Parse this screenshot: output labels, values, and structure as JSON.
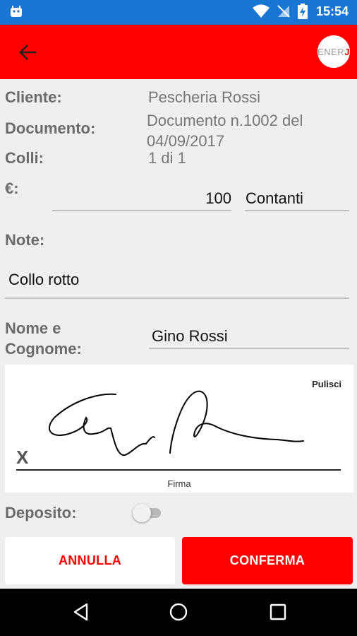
{
  "status_bar": {
    "time": "15:54",
    "icons": [
      "android-icon",
      "wifi-icon",
      "no-sim-icon",
      "battery-charging-icon"
    ]
  },
  "app_bar": {
    "back_icon": "arrow-left-icon",
    "logo": {
      "part1": "ENER",
      "part2": "J"
    },
    "colors": {
      "accent": "#ff0000"
    }
  },
  "form": {
    "cliente": {
      "label": "Cliente:",
      "value": "Pescheria Rossi"
    },
    "documento": {
      "label": "Documento:",
      "line1": "Documento n.1002 del",
      "line2": "04/09/2017"
    },
    "colli": {
      "label": "Colli:",
      "value": "1 di 1"
    },
    "amount": {
      "label": "€:",
      "value": "100",
      "payment": "Contanti"
    },
    "note": {
      "label": "Note:",
      "value": "Collo rotto"
    },
    "nome": {
      "label_line1": "Nome e",
      "label_line2": "Cognome:",
      "value": "Gino Rossi"
    }
  },
  "signature": {
    "clear_label": "Pulisci",
    "x_mark": "X",
    "caption": "Firma"
  },
  "deposito": {
    "label": "Deposito:",
    "checked": false
  },
  "buttons": {
    "cancel": "ANNULLA",
    "confirm": "CONFERMA"
  },
  "nav_bar": {
    "icons": [
      "back-triangle-icon",
      "home-circle-icon",
      "recents-square-icon"
    ]
  }
}
